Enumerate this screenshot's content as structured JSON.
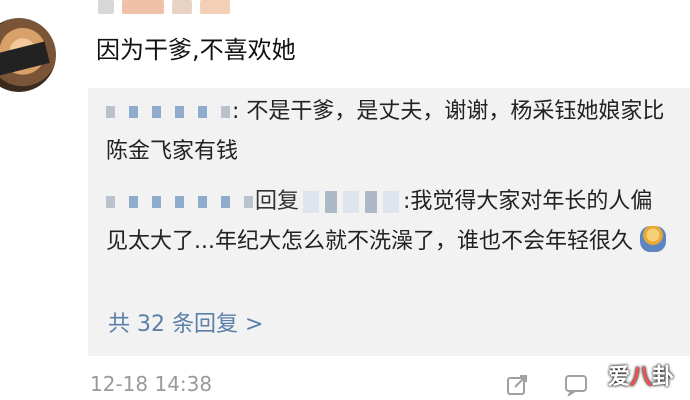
{
  "comment": {
    "text": "因为干爹,不喜欢她",
    "timestamp": "12-18 14:38"
  },
  "replies": [
    {
      "text": ": 不是干爹，是丈夫，谢谢，杨采钰她娘家比陈金飞家有钱"
    },
    {
      "action": "回复",
      "text": ":我觉得大家对年长的人偏见太大了...年纪大怎么就不洗澡了，谁也不会年轻很久"
    }
  ],
  "more_replies": "共 32 条回复 >",
  "watermark": {
    "left": "爱",
    "middle": "八",
    "right": "卦"
  },
  "icons": {
    "share": "share-icon",
    "comment": "comment-icon",
    "emoji": "shrug-emoji"
  },
  "colors": {
    "link": "#5a7fa8",
    "reply_bg": "#f2f2f2"
  }
}
